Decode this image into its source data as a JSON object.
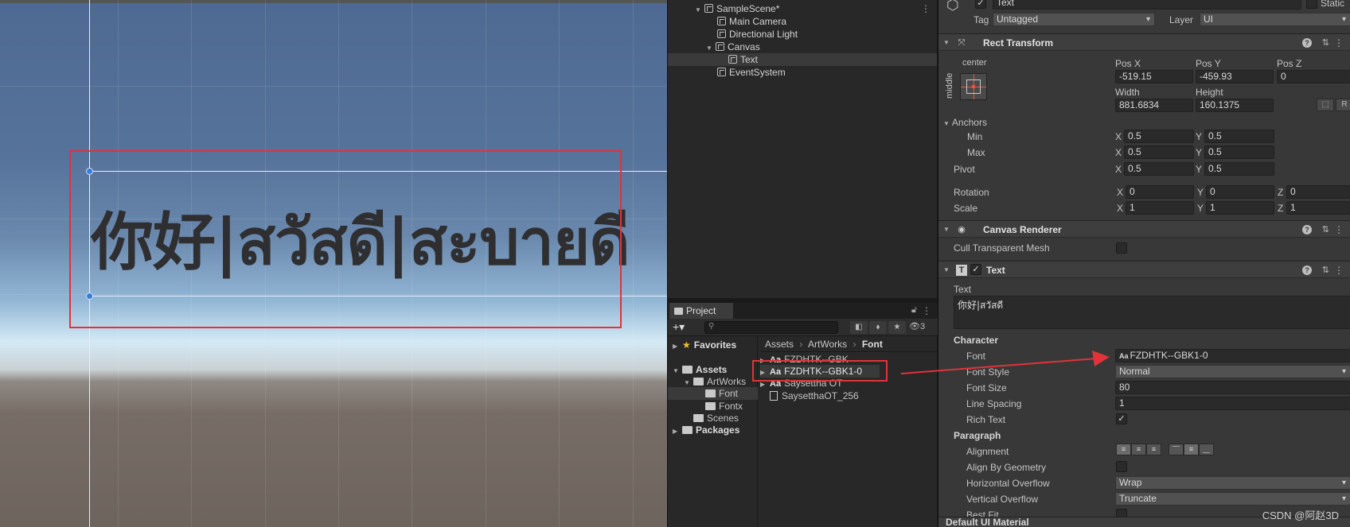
{
  "scene": {
    "text_content": "你好|สวัสดี|สะบายดี"
  },
  "hierarchy": {
    "items": [
      {
        "label": "SampleScene*",
        "indent": 0
      },
      {
        "label": "Main Camera",
        "indent": 1
      },
      {
        "label": "Directional Light",
        "indent": 1
      },
      {
        "label": "Canvas",
        "indent": 1
      },
      {
        "label": "Text",
        "indent": 2
      },
      {
        "label": "EventSystem",
        "indent": 1
      }
    ]
  },
  "project": {
    "tab_label": "Project",
    "hidden_count": "3",
    "tree": [
      {
        "label": "Favorites",
        "bold": true
      },
      {
        "label": "Assets",
        "bold": true
      },
      {
        "label": "ArtWorks"
      },
      {
        "label": "Font"
      },
      {
        "label": "Fontx"
      },
      {
        "label": "Scenes"
      },
      {
        "label": "Packages",
        "bold": true
      }
    ],
    "breadcrumb": [
      "Assets",
      "ArtWorks",
      "Font"
    ],
    "files": [
      {
        "label": "FZDHTK--GBK",
        "icon": "Aa"
      },
      {
        "label": "FZDHTK--GBK1-0",
        "icon": "Aa"
      },
      {
        "label": "Saysettha OT",
        "icon": "Aa"
      },
      {
        "label": "SaysetthaOT_256",
        "icon": "doc"
      }
    ]
  },
  "inspector": {
    "object_name": "Text",
    "static_label": "Static",
    "tag_label": "Tag",
    "tag_value": "Untagged",
    "layer_label": "Layer",
    "layer_value": "UI",
    "rect_transform": {
      "title": "Rect Transform",
      "anchor_h": "center",
      "anchor_v": "middle",
      "pos_x_label": "Pos X",
      "pos_x": "-519.15",
      "pos_y_label": "Pos Y",
      "pos_y": "-459.93",
      "pos_z_label": "Pos Z",
      "pos_z": "0",
      "width_label": "Width",
      "width": "881.6834",
      "height_label": "Height",
      "height": "160.1375",
      "r_button": "R",
      "anchors_label": "Anchors",
      "min_label": "Min",
      "min_x": "0.5",
      "min_y": "0.5",
      "max_label": "Max",
      "max_x": "0.5",
      "max_y": "0.5",
      "pivot_label": "Pivot",
      "pivot_x": "0.5",
      "pivot_y": "0.5",
      "rotation_label": "Rotation",
      "rot_x": "0",
      "rot_y": "0",
      "rot_z": "0",
      "scale_label": "Scale",
      "scale_x": "1",
      "scale_y": "1",
      "scale_z": "1",
      "x": "X",
      "y": "Y",
      "z": "Z"
    },
    "canvas_renderer": {
      "title": "Canvas Renderer",
      "cull_label": "Cull Transparent Mesh"
    },
    "text": {
      "title": "Text",
      "text_label": "Text",
      "text_value": "你好|สวัสดี",
      "character_label": "Character",
      "font_label": "Font",
      "font_value": "FZDHTK--GBK1-0",
      "font_icon": "Aa",
      "font_style_label": "Font Style",
      "font_style_value": "Normal",
      "font_size_label": "Font Size",
      "font_size_value": "80",
      "line_spacing_label": "Line Spacing",
      "line_spacing_value": "1",
      "rich_text_label": "Rich Text",
      "paragraph_label": "Paragraph",
      "alignment_label": "Alignment",
      "align_geometry_label": "Align By Geometry",
      "h_overflow_label": "Horizontal Overflow",
      "h_overflow_value": "Wrap",
      "v_overflow_label": "Vertical Overflow",
      "v_overflow_value": "Truncate",
      "best_fit_label": "Best Fit"
    },
    "material_label": "Default UI Material"
  },
  "watermark": "CSDN @阿赵3D",
  "colors": {
    "highlight_red": "#e0333a",
    "rect_handle_blue": "#3a7bd5"
  }
}
